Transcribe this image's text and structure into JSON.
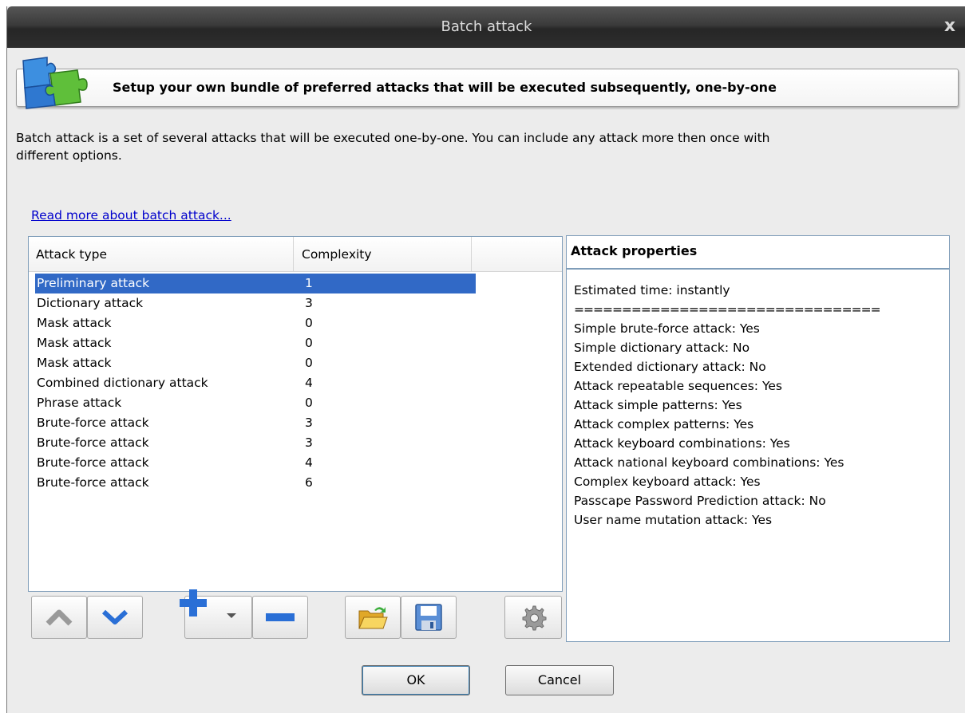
{
  "window": {
    "title": "Batch attack",
    "close_glyph": "x"
  },
  "banner": {
    "text": "Setup your own bundle of preferred attacks that will be executed subsequently, one-by-one",
    "icon": "puzzle-icon"
  },
  "description": {
    "line1": "Batch attack is a set of several attacks that will be executed one-by-one. You can include any attack more then once with",
    "line2": "different options."
  },
  "link": {
    "read_more": "Read more about batch attack..."
  },
  "attack_list": {
    "columns": {
      "attack_type": "Attack type",
      "complexity": "Complexity"
    },
    "rows": [
      {
        "type": "Preliminary attack",
        "complexity": "1"
      },
      {
        "type": "Dictionary attack",
        "complexity": "3"
      },
      {
        "type": "Mask attack",
        "complexity": "0"
      },
      {
        "type": "Mask attack",
        "complexity": "0"
      },
      {
        "type": "Mask attack",
        "complexity": "0"
      },
      {
        "type": "Combined dictionary attack",
        "complexity": "4"
      },
      {
        "type": "Phrase attack",
        "complexity": "0"
      },
      {
        "type": "Brute-force attack",
        "complexity": "3"
      },
      {
        "type": "Brute-force attack",
        "complexity": "3"
      },
      {
        "type": "Brute-force attack",
        "complexity": "4"
      },
      {
        "type": "Brute-force attack",
        "complexity": "6"
      }
    ],
    "selected_index": 0
  },
  "properties": {
    "title": "Attack properties",
    "lines": [
      "Estimated time: instantly",
      "================================",
      "Simple brute-force attack: Yes",
      "Simple dictionary attack: No",
      "Extended dictionary attack: No",
      "Attack repeatable sequences: Yes",
      "Attack simple patterns: Yes",
      "Attack complex patterns: Yes",
      "Attack keyboard combinations: Yes",
      "Attack national keyboard combinations: Yes",
      "Complex keyboard attack: Yes",
      "Passcape Password Prediction attack: No",
      "User name mutation attack: Yes"
    ]
  },
  "toolbar": {
    "icons": [
      "move-up-icon",
      "move-down-icon",
      "add-icon",
      "remove-icon",
      "open-folder-icon",
      "save-icon",
      "settings-gear-icon"
    ]
  },
  "buttons": {
    "ok": "OK",
    "cancel": "Cancel"
  },
  "colors": {
    "selection": "#3169c6",
    "link": "#0000cc",
    "accent_blue": "#2a6fd6"
  }
}
